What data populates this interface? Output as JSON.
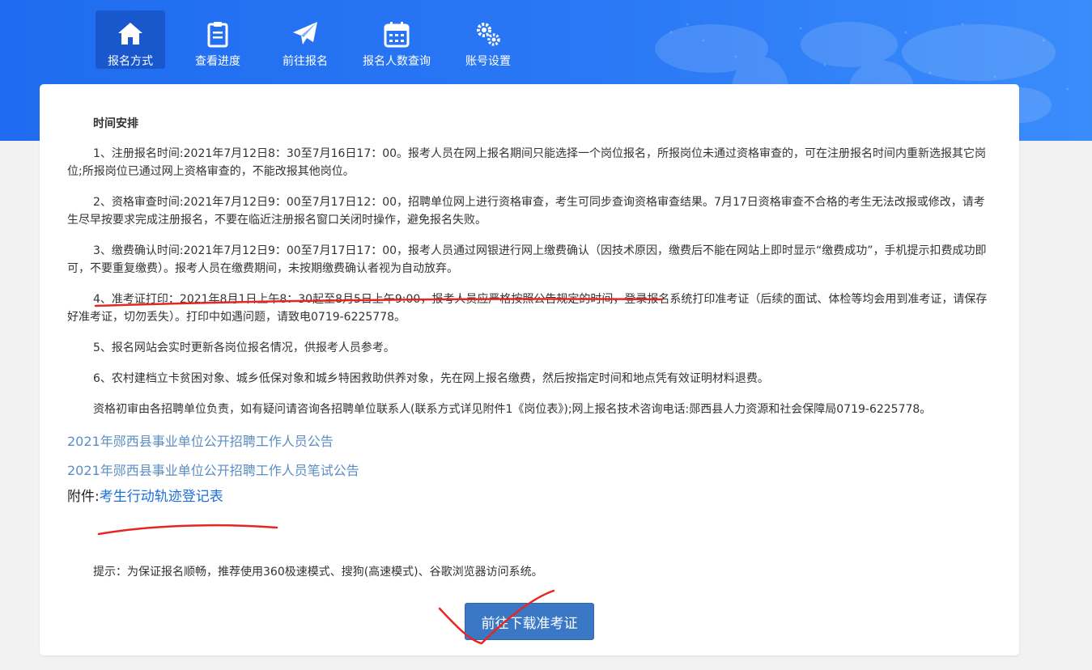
{
  "nav": {
    "items": [
      {
        "label": "报名方式",
        "icon": "home-icon",
        "active": true
      },
      {
        "label": "查看进度",
        "icon": "clipboard-icon",
        "active": false
      },
      {
        "label": "前往报名",
        "icon": "paper-plane-icon",
        "active": false
      },
      {
        "label": "报名人数查询",
        "icon": "calendar-icon",
        "active": false
      },
      {
        "label": "账号设置",
        "icon": "gears-icon",
        "active": false
      }
    ]
  },
  "content": {
    "section_title": "时间安排",
    "paragraphs": [
      "1、注册报名时间:2021年7月12日8：30至7月16日17：00。报考人员在网上报名期间只能选择一个岗位报名，所报岗位未通过资格审查的，可在注册报名时间内重新选报其它岗位;所报岗位已通过网上资格审查的，不能改报其他岗位。",
      "2、资格审查时间:2021年7月12日9：00至7月17日12：00，招聘单位网上进行资格审查，考生可同步查询资格审查结果。7月17日资格审查不合格的考生无法改报或修改，请考生尽早按要求完成注册报名，不要在临近注册报名窗口关闭时操作，避免报名失败。",
      "3、缴费确认时间:2021年7月12日9：00至7月17日17：00，报考人员通过网银进行网上缴费确认（因技术原因，缴费后不能在网站上即时显示“缴费成功”，手机提示扣费成功即可，不要重复缴费）。报考人员在缴费期间，未按期缴费确认者视为自动放弃。",
      "4、准考证打印：2021年8月1日上午8：30起至8月5日上午9:00，报考人员应严格按照公告规定的时间，登录报名系统打印准考证（后续的面试、体检等均会用到准考证，请保存好准考证，切勿丢失）。打印中如遇问题，请致电0719-6225778。",
      "5、报名网站会实时更新各岗位报名情况，供报考人员参考。",
      "6、农村建档立卡贫困对象、城乡低保对象和城乡特困救助供养对象，先在网上报名缴费，然后按指定时间和地点凭有效证明材料退费。",
      "资格初审由各招聘单位负责，如有疑问请咨询各招聘单位联系人(联系方式详见附件1《岗位表》);网上报名技术咨询电话:郧西县人力资源和社会保障局0719-6225778。"
    ],
    "links": [
      "2021年郧西县事业单位公开招聘工作人员公告",
      "2021年郧西县事业单位公开招聘工作人员笔试公告"
    ],
    "attachment_prefix": "附件:",
    "attachment_link": "考生行动轨迹登记表",
    "tip": "提示：为保证报名顺畅，推荐使用360极速模式、搜狗(高速模式)、谷歌浏览器访问系统。",
    "download_button": "前往下载准考证"
  },
  "colors": {
    "header_blue": "#2a78f5",
    "active_nav": "#1858cc",
    "link_blue": "#5b8ec4",
    "button_blue": "#3a78c6",
    "annotation_red": "#e8261f"
  }
}
